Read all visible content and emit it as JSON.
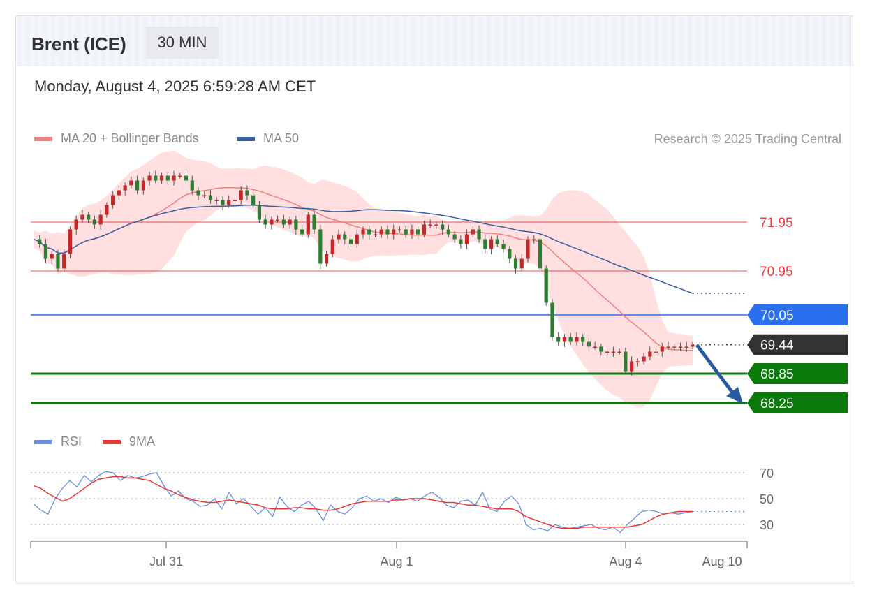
{
  "header": {
    "instrument": "Brent (ICE)",
    "timeframe": "30 MIN",
    "datetime": "Monday, August 4, 2025 6:59:28 AM CET"
  },
  "legend": {
    "ma20_label": "MA 20 + Bollinger Bands",
    "ma50_label": "MA 50",
    "credit": "Research © 2025 Trading Central"
  },
  "rsi_legend": {
    "rsi_label": "RSI",
    "ma_label": "9MA"
  },
  "colors": {
    "resistance": "#f03c3c",
    "pivot": "#2a6fee",
    "support": "#0a7a0a",
    "last": "#333333",
    "ma20": "#f08080",
    "band": "#ffd4d4",
    "ma50": "#3a5fa0",
    "bull": "#c62828",
    "bear": "#2e7d32",
    "rsi": "#6a8fe0",
    "rsi_ma": "#e53935"
  },
  "chart_data": [
    {
      "type": "candlestick",
      "x_ticks": [
        "Jul 31",
        "Aug 1",
        "Aug 4",
        "Aug 10"
      ],
      "levels": [
        {
          "value": 71.95,
          "label": "71.95",
          "role": "resistance"
        },
        {
          "value": 70.95,
          "label": "70.95",
          "role": "resistance"
        },
        {
          "value": 70.05,
          "label": "70.05",
          "role": "pivot"
        },
        {
          "value": 69.44,
          "label": "69.44",
          "role": "last"
        },
        {
          "value": 68.85,
          "label": "68.85",
          "role": "support"
        },
        {
          "value": 68.25,
          "label": "68.25",
          "role": "support"
        }
      ],
      "ylim": [
        67.8,
        73.2
      ],
      "direction": "down",
      "closes": [
        71.6,
        71.5,
        71.2,
        71.3,
        71.0,
        71.3,
        71.8,
        72.0,
        72.1,
        72.0,
        71.9,
        72.1,
        72.3,
        72.5,
        72.6,
        72.7,
        72.8,
        72.6,
        72.8,
        72.9,
        72.8,
        72.9,
        72.8,
        72.9,
        72.9,
        72.8,
        72.6,
        72.5,
        72.5,
        72.4,
        72.4,
        72.3,
        72.4,
        72.4,
        72.6,
        72.5,
        72.3,
        72.0,
        71.9,
        72.0,
        72.0,
        71.9,
        72.0,
        71.8,
        71.7,
        72.1,
        71.8,
        71.1,
        71.3,
        71.6,
        71.7,
        71.6,
        71.5,
        71.7,
        71.8,
        71.7,
        71.7,
        71.8,
        71.7,
        71.8,
        71.8,
        71.7,
        71.8,
        71.7,
        71.9,
        71.9,
        71.9,
        71.8,
        71.7,
        71.6,
        71.5,
        71.7,
        71.8,
        71.6,
        71.4,
        71.6,
        71.5,
        71.4,
        71.2,
        71.0,
        71.2,
        71.6,
        71.6,
        71.0,
        70.3,
        69.6,
        69.5,
        69.6,
        69.5,
        69.6,
        69.5,
        69.4,
        69.4,
        69.3,
        69.3,
        69.3,
        69.3,
        68.9,
        69.1,
        69.1,
        69.2,
        69.3,
        69.3,
        69.4,
        69.4,
        69.4,
        69.4,
        69.4,
        69.44
      ],
      "rsi": {
        "levels": [
          70,
          50,
          30
        ],
        "ylim": [
          20,
          75
        ],
        "values": [
          46,
          41,
          38,
          50,
          58,
          64,
          59,
          68,
          63,
          68,
          71,
          70,
          64,
          68,
          66,
          67,
          69,
          70,
          60,
          52,
          56,
          50,
          48,
          44,
          45,
          50,
          42,
          55,
          46,
          50,
          44,
          38,
          43,
          36,
          51,
          44,
          40,
          45,
          48,
          42,
          33,
          45,
          40,
          38,
          43,
          50,
          52,
          48,
          50,
          47,
          51,
          49,
          50,
          48,
          52,
          55,
          51,
          45,
          43,
          48,
          49,
          45,
          55,
          42,
          40,
          48,
          52,
          46,
          30,
          26,
          27,
          25,
          30,
          28,
          27,
          28,
          29,
          30,
          27,
          26,
          28,
          24,
          30,
          35,
          40,
          41,
          40,
          38,
          39,
          38,
          39,
          40
        ],
        "ma_values": [
          60,
          58,
          54,
          51,
          48,
          50,
          54,
          58,
          62,
          65,
          66,
          67,
          67,
          66,
          66,
          65,
          64,
          61,
          58,
          56,
          53,
          51,
          49,
          48,
          47,
          47,
          48,
          49,
          48,
          47,
          46,
          45,
          43,
          42,
          42,
          42,
          43,
          43,
          42,
          42,
          41,
          41,
          42,
          44,
          46,
          47,
          48,
          48,
          48,
          48,
          49,
          49,
          50,
          50,
          50,
          49,
          48,
          47,
          47,
          46,
          45,
          45,
          44,
          43,
          42,
          42,
          42,
          40,
          36,
          34,
          32,
          30,
          28,
          27,
          27,
          27,
          28,
          28,
          28,
          28,
          28,
          28,
          28,
          29,
          30,
          33,
          36,
          38,
          39,
          40,
          40,
          40
        ]
      }
    }
  ]
}
